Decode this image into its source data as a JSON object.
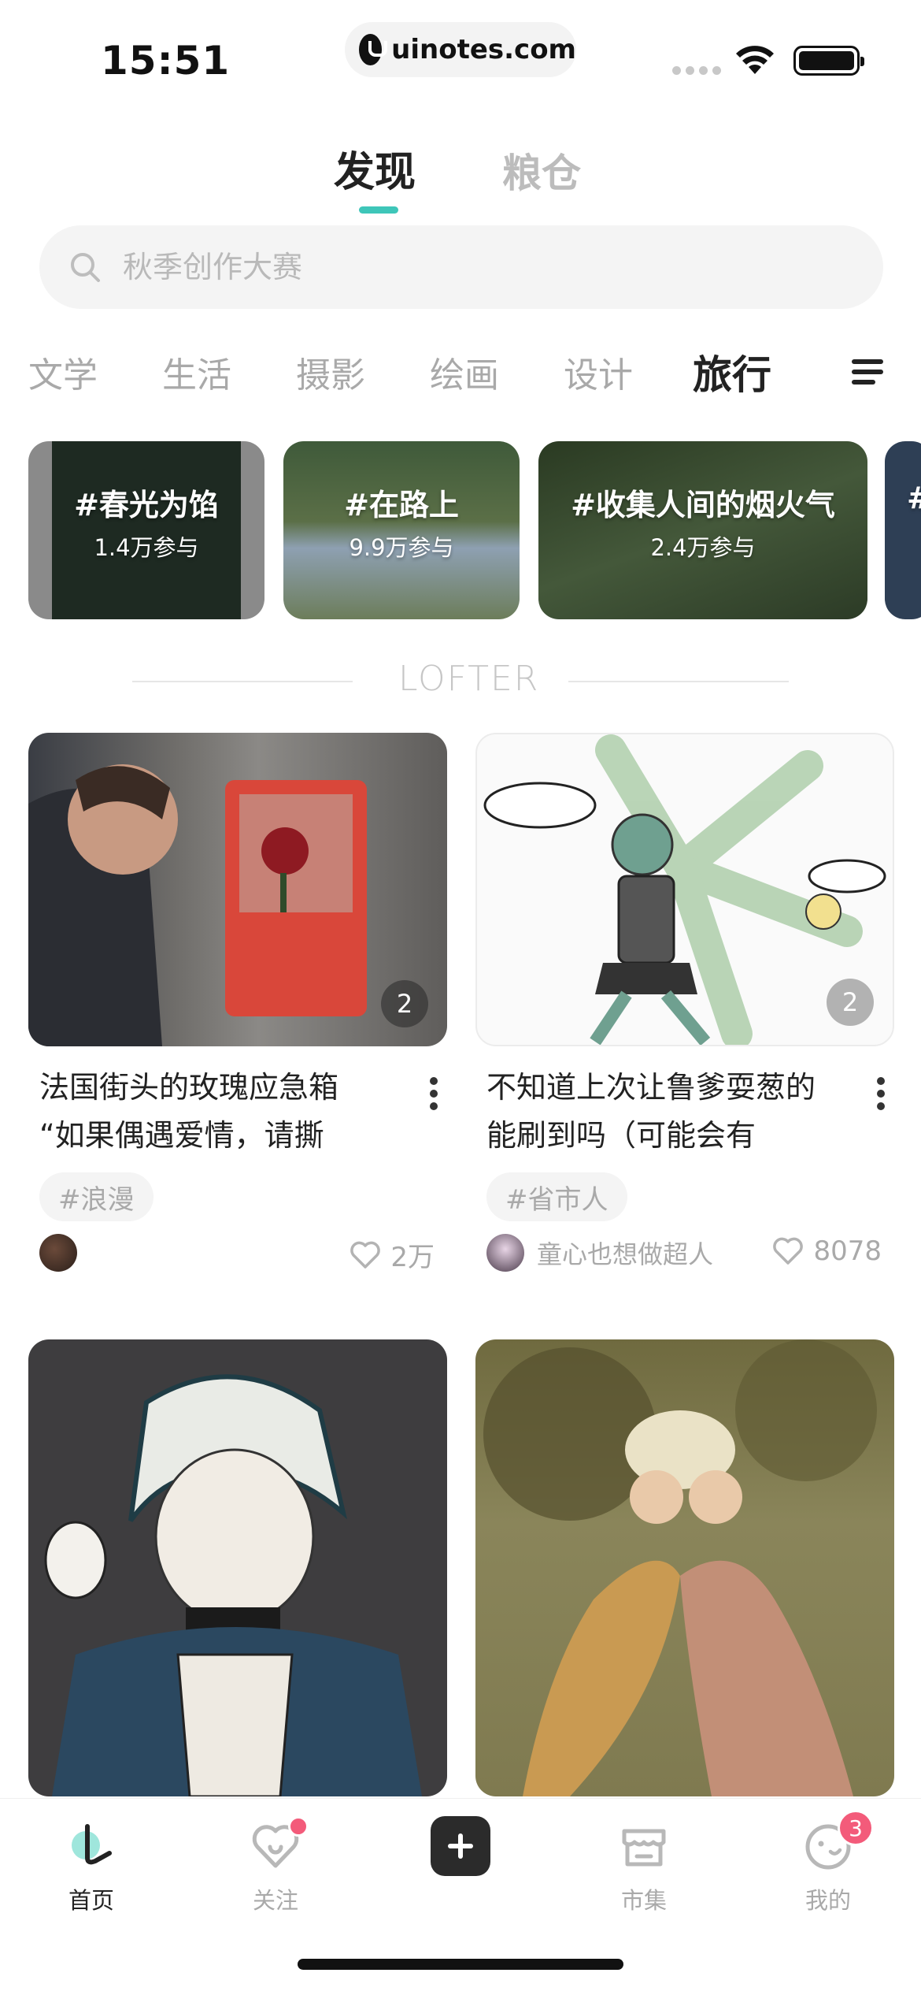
{
  "status_bar": {
    "time": "15:51",
    "url": "uinotes.com"
  },
  "top_tabs": [
    {
      "label": "发现",
      "active": true
    },
    {
      "label": "粮仓",
      "active": false
    }
  ],
  "search": {
    "placeholder": "秋季创作大赛",
    "value": ""
  },
  "categories": [
    {
      "label": "文学",
      "active": false
    },
    {
      "label": "生活",
      "active": false
    },
    {
      "label": "摄影",
      "active": false
    },
    {
      "label": "绘画",
      "active": false
    },
    {
      "label": "设计",
      "active": false
    },
    {
      "label": "旅行",
      "active": true
    }
  ],
  "topics": [
    {
      "title": "#春光为馅",
      "count": "1.4万参与"
    },
    {
      "title": "#在路上",
      "count": "9.9万参与"
    },
    {
      "title": "#收集人间的烟火气",
      "count": "2.4万参与"
    },
    {
      "title": "#",
      "count": ""
    }
  ],
  "brand_divider": "LOFTER",
  "feed": [
    {
      "title": "法国街头的玫瑰应急箱 “如果偶遇爱情，请撕",
      "image_count": "2",
      "tag": "#浪漫",
      "author": "",
      "likes": "2万"
    },
    {
      "title": "不知道上次让鲁爹耍葱的能刷到吗（可能会有",
      "image_count": "2",
      "tag": "#省市人",
      "author": "童心也想做超人",
      "likes": "8078"
    },
    {
      "title": "",
      "image_count": "",
      "tag": "",
      "author": "",
      "likes": ""
    },
    {
      "title": "",
      "image_count": "",
      "tag": "",
      "author": "",
      "likes": ""
    }
  ],
  "bottom_nav": [
    {
      "label": "首页",
      "icon": "home-icon",
      "active": true
    },
    {
      "label": "关注",
      "icon": "heart-follow-icon",
      "active": false,
      "dot": true
    },
    {
      "label": "",
      "icon": "plus-icon",
      "active": false
    },
    {
      "label": "市集",
      "icon": "market-icon",
      "active": false
    },
    {
      "label": "我的",
      "icon": "profile-face-icon",
      "active": false,
      "badge": "3"
    }
  ],
  "colors": {
    "accent": "#3ec6b9",
    "badge": "#f35b7a",
    "muted_text": "#a9a9a9",
    "search_bg": "#f4f4f4"
  }
}
